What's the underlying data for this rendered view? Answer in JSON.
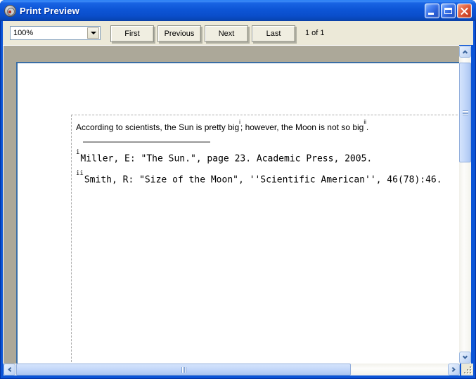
{
  "window": {
    "title": "Print Preview"
  },
  "toolbar": {
    "zoom_value": "100%",
    "buttons": [
      {
        "id": "first",
        "label": "First"
      },
      {
        "id": "previous",
        "label": "Previous"
      },
      {
        "id": "next",
        "label": "Next"
      },
      {
        "id": "last",
        "label": "Last"
      }
    ],
    "page_indicator": "1 of 1"
  },
  "document": {
    "body_line": {
      "text_start": "According to scientists, the Sun is pretty big",
      "footnote_ref_1": "i",
      "text_middle": "; however, the Moon is not so big",
      "footnote_ref_2": "ii",
      "text_end": "."
    },
    "footnotes": [
      {
        "marker": "i",
        "text": "Miller, E: \"The Sun.\", page 23. Academic Press, 2005."
      },
      {
        "marker": "ii",
        "text": "Smith, R: \"Size of the Moon\", ''Scientific American'', 46(78):46."
      }
    ]
  },
  "icons": {
    "app": "print-preview-app-icon",
    "minimize": "underscore-bar",
    "maximize": "window-square",
    "close": "x-cross",
    "combo_arrow": "triangle-down",
    "scroll_up": "chevron-up",
    "scroll_down": "chevron-down",
    "scroll_left": "chevron-left",
    "scroll_right": "chevron-right",
    "resize_grip": "diagonal-dots"
  },
  "colors": {
    "titlebar_blue": "#0B54D6",
    "toolbar_face": "#ECE9D8",
    "workspace_gray": "#ACA899",
    "page_border_blue": "#3A6EA5",
    "close_button_red": "#D8492E",
    "scrollbar_thumb_blue": "#C2D6F9"
  }
}
